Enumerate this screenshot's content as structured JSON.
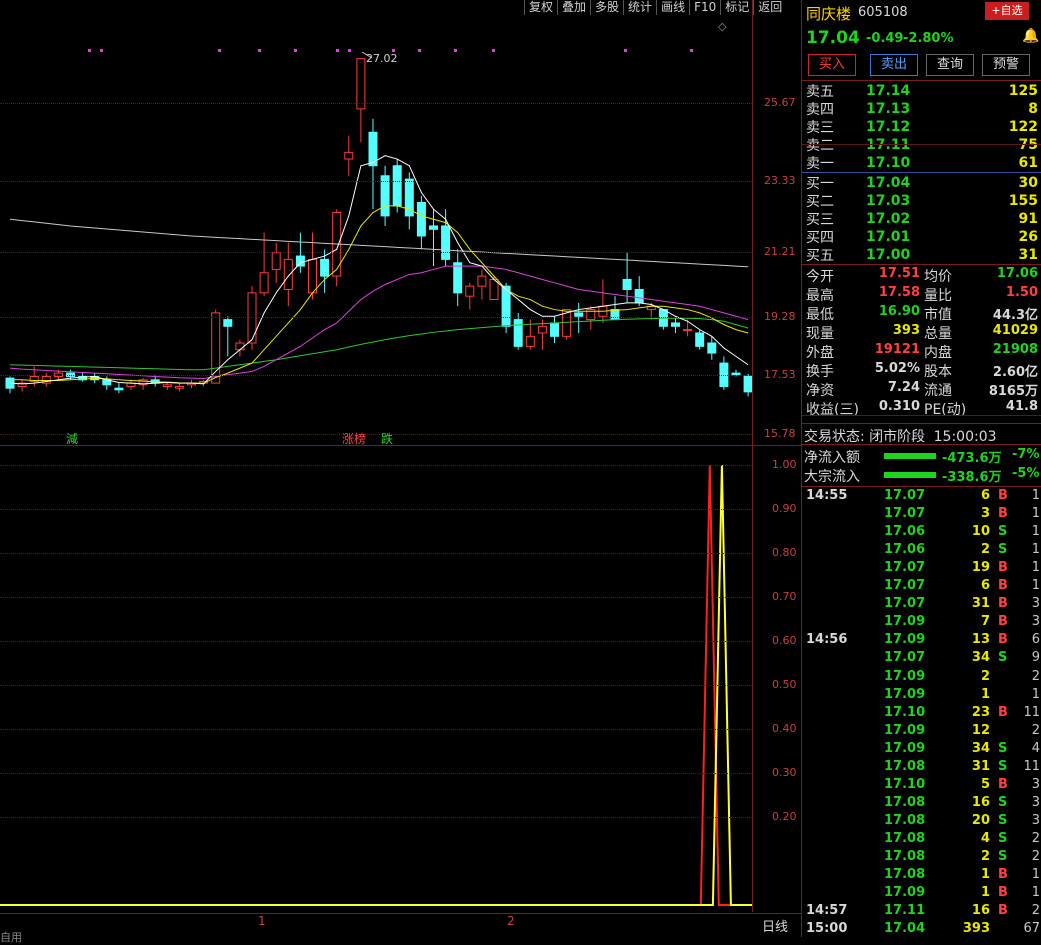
{
  "toolbar": [
    "复权",
    "叠加",
    "多股",
    "统计",
    "画线",
    "F10",
    "标记",
    "返回"
  ],
  "stock": {
    "name": "同庆楼",
    "code": "605108",
    "price": "17.04",
    "change": "-0.49",
    "pct": "-2.80%",
    "add_fav": "+自选"
  },
  "trade_buttons": {
    "buy": "买入",
    "sell": "卖出",
    "query": "查询",
    "alert": "预警"
  },
  "sell_orders": [
    {
      "label": "卖五",
      "price": "17.14",
      "vol": "125"
    },
    {
      "label": "卖四",
      "price": "17.13",
      "vol": "8"
    },
    {
      "label": "卖三",
      "price": "17.12",
      "vol": "122"
    },
    {
      "label": "卖二",
      "price": "17.11",
      "vol": "75"
    },
    {
      "label": "卖一",
      "price": "17.10",
      "vol": "61"
    }
  ],
  "buy_orders": [
    {
      "label": "买一",
      "price": "17.04",
      "vol": "30"
    },
    {
      "label": "买二",
      "price": "17.03",
      "vol": "155"
    },
    {
      "label": "买三",
      "price": "17.02",
      "vol": "91"
    },
    {
      "label": "买四",
      "price": "17.01",
      "vol": "26"
    },
    {
      "label": "买五",
      "price": "17.00",
      "vol": "31"
    }
  ],
  "quote": {
    "open_l": "今开",
    "open": "17.51",
    "avg_l": "均价",
    "avg": "17.06",
    "high_l": "最高",
    "high": "17.58",
    "vr_l": "量比",
    "vr": "1.50",
    "low_l": "最低",
    "low": "16.90",
    "mcap_l": "市值",
    "mcap": "44.3亿",
    "cur_l": "现量",
    "cur": "393",
    "tot_l": "总量",
    "tot": "41029",
    "out_l": "外盘",
    "out": "19121",
    "in_l": "内盘",
    "in": "21908",
    "turn_l": "换手",
    "turn": "5.02%",
    "shares_l": "股本",
    "shares": "2.60亿",
    "nav_l": "净资",
    "nav": "7.24",
    "float_l": "流通",
    "float": "8165万",
    "eps_l": "收益(三)",
    "eps": "0.310",
    "pe_l": "PE(动)",
    "pe": "41.8"
  },
  "status": {
    "label": "交易状态:",
    "state": "闭市阶段",
    "time": "15:00:03"
  },
  "flows": [
    {
      "label": "净流入额",
      "value": "-473.6万",
      "pct": "-7%"
    },
    {
      "label": "大宗流入",
      "value": "-338.6万",
      "pct": "-5%"
    }
  ],
  "ticks": [
    {
      "t": "14:55",
      "p": "17.07",
      "v": "6",
      "s": "B",
      "n": "1"
    },
    {
      "t": "",
      "p": "17.07",
      "v": "3",
      "s": "B",
      "n": "1"
    },
    {
      "t": "",
      "p": "17.06",
      "v": "10",
      "s": "S",
      "n": "1"
    },
    {
      "t": "",
      "p": "17.06",
      "v": "2",
      "s": "S",
      "n": "1"
    },
    {
      "t": "",
      "p": "17.07",
      "v": "19",
      "s": "B",
      "n": "1"
    },
    {
      "t": "",
      "p": "17.07",
      "v": "6",
      "s": "B",
      "n": "1"
    },
    {
      "t": "",
      "p": "17.07",
      "v": "31",
      "s": "B",
      "n": "3"
    },
    {
      "t": "",
      "p": "17.09",
      "v": "7",
      "s": "B",
      "n": "3"
    },
    {
      "t": "14:56",
      "p": "17.09",
      "v": "13",
      "s": "B",
      "n": "6"
    },
    {
      "t": "",
      "p": "17.07",
      "v": "34",
      "s": "S",
      "n": "9"
    },
    {
      "t": "",
      "p": "17.09",
      "v": "2",
      "s": "",
      "n": "2"
    },
    {
      "t": "",
      "p": "17.09",
      "v": "1",
      "s": "",
      "n": "1"
    },
    {
      "t": "",
      "p": "17.10",
      "v": "23",
      "s": "B",
      "n": "11"
    },
    {
      "t": "",
      "p": "17.09",
      "v": "12",
      "s": "",
      "n": "2"
    },
    {
      "t": "",
      "p": "17.09",
      "v": "34",
      "s": "S",
      "n": "4"
    },
    {
      "t": "",
      "p": "17.08",
      "v": "31",
      "s": "S",
      "n": "11"
    },
    {
      "t": "",
      "p": "17.10",
      "v": "5",
      "s": "B",
      "n": "3"
    },
    {
      "t": "",
      "p": "17.08",
      "v": "16",
      "s": "S",
      "n": "3"
    },
    {
      "t": "",
      "p": "17.08",
      "v": "20",
      "s": "S",
      "n": "3"
    },
    {
      "t": "",
      "p": "17.08",
      "v": "4",
      "s": "S",
      "n": "2"
    },
    {
      "t": "",
      "p": "17.08",
      "v": "2",
      "s": "S",
      "n": "2"
    },
    {
      "t": "",
      "p": "17.08",
      "v": "1",
      "s": "B",
      "n": "1"
    },
    {
      "t": "",
      "p": "17.09",
      "v": "1",
      "s": "B",
      "n": "1"
    },
    {
      "t": "14:57",
      "p": "17.11",
      "v": "16",
      "s": "B",
      "n": "2"
    },
    {
      "t": "15:00",
      "p": "17.04",
      "v": "393",
      "s": "",
      "n": "67"
    }
  ],
  "price_axis": [
    "25.67",
    "23.33",
    "21.21",
    "19.28",
    "17.53",
    "15.78"
  ],
  "indicator_axis": [
    "1.00",
    "0.90",
    "0.80",
    "0.70",
    "0.60",
    "0.50",
    "0.40",
    "0.30",
    "0.20"
  ],
  "max_label": "27.02",
  "chart_markers": {
    "m1": "減",
    "m2": "涨榜",
    "m3": "跌"
  },
  "x_labels": [
    "1",
    "2"
  ],
  "period_label": "日线",
  "bottom_tab": "自用",
  "colors": {
    "up": "#ff3c3c",
    "down": "#54ffff",
    "ma5": "#ffffff",
    "ma10": "#e8e800",
    "ma20": "#e040e0",
    "ma60": "#2ec82e",
    "ma120": "#c8c8c8"
  },
  "chart_data": {
    "type": "candlestick",
    "ylim": [
      15.78,
      27.5
    ],
    "candles": [
      [
        17.45,
        17.5,
        17.0,
        17.15
      ],
      [
        17.2,
        17.4,
        17.05,
        17.3
      ],
      [
        17.35,
        17.8,
        17.2,
        17.5
      ],
      [
        17.3,
        17.6,
        17.2,
        17.5
      ],
      [
        17.5,
        17.7,
        17.4,
        17.6
      ],
      [
        17.6,
        17.7,
        17.4,
        17.5
      ],
      [
        17.5,
        17.6,
        17.35,
        17.4
      ],
      [
        17.5,
        17.6,
        17.3,
        17.4
      ],
      [
        17.4,
        17.5,
        17.1,
        17.25
      ],
      [
        17.15,
        17.3,
        17.0,
        17.1
      ],
      [
        17.2,
        17.4,
        17.1,
        17.3
      ],
      [
        17.25,
        17.45,
        17.1,
        17.4
      ],
      [
        17.4,
        17.55,
        17.2,
        17.3
      ],
      [
        17.2,
        17.3,
        17.1,
        17.25
      ],
      [
        17.15,
        17.3,
        17.05,
        17.2
      ],
      [
        17.25,
        17.4,
        17.15,
        17.3
      ],
      [
        17.3,
        17.4,
        17.2,
        17.35
      ],
      [
        17.3,
        19.5,
        17.3,
        19.4
      ],
      [
        19.2,
        19.3,
        18.1,
        19.0
      ],
      [
        18.3,
        18.6,
        18.1,
        18.5
      ],
      [
        18.5,
        20.2,
        18.3,
        20.0
      ],
      [
        20.0,
        21.8,
        19.9,
        20.6
      ],
      [
        20.7,
        21.5,
        20.3,
        21.2
      ],
      [
        20.1,
        21.5,
        19.6,
        21.0
      ],
      [
        21.1,
        21.8,
        20.6,
        20.8
      ],
      [
        20.0,
        21.8,
        19.8,
        21.0
      ],
      [
        21.0,
        21.3,
        20.0,
        20.5
      ],
      [
        20.5,
        22.5,
        20.2,
        22.4
      ],
      [
        24.0,
        24.7,
        23.5,
        24.2
      ],
      [
        25.5,
        27.02,
        24.5,
        27.0
      ],
      [
        24.8,
        25.2,
        22.5,
        23.8
      ],
      [
        23.5,
        23.8,
        22.0,
        22.3
      ],
      [
        23.8,
        24.0,
        22.4,
        22.6
      ],
      [
        23.4,
        23.6,
        21.9,
        22.3
      ],
      [
        22.7,
        22.9,
        21.3,
        21.7
      ],
      [
        22.0,
        22.5,
        20.8,
        21.9
      ],
      [
        22.0,
        22.5,
        20.8,
        21.0
      ],
      [
        20.9,
        21.3,
        19.6,
        20.0
      ],
      [
        19.9,
        20.3,
        19.5,
        20.2
      ],
      [
        20.2,
        20.7,
        19.8,
        20.5
      ],
      [
        19.8,
        20.5,
        19.8,
        20.4
      ],
      [
        20.2,
        20.3,
        18.8,
        19.0
      ],
      [
        19.2,
        19.4,
        18.3,
        18.4
      ],
      [
        18.4,
        19.2,
        18.3,
        18.7
      ],
      [
        18.8,
        19.2,
        18.3,
        19.0
      ],
      [
        19.1,
        19.3,
        18.5,
        18.7
      ],
      [
        18.7,
        19.5,
        18.6,
        19.5
      ],
      [
        19.4,
        19.7,
        18.8,
        19.3
      ],
      [
        19.2,
        19.6,
        18.9,
        19.5
      ],
      [
        19.3,
        20.4,
        19.1,
        19.6
      ],
      [
        19.5,
        19.9,
        19.2,
        19.2
      ],
      [
        20.4,
        21.2,
        19.7,
        20.1
      ],
      [
        20.1,
        20.5,
        19.6,
        19.7
      ],
      [
        19.5,
        19.7,
        19.2,
        19.6
      ],
      [
        19.5,
        19.5,
        18.9,
        19.0
      ],
      [
        19.1,
        19.3,
        18.8,
        19.0
      ],
      [
        18.9,
        19.2,
        18.7,
        18.9
      ],
      [
        18.8,
        18.9,
        18.3,
        18.4
      ],
      [
        18.5,
        18.7,
        18.0,
        18.2
      ],
      [
        17.9,
        18.1,
        17.1,
        17.2
      ],
      [
        17.6,
        17.7,
        17.5,
        17.55
      ],
      [
        17.51,
        17.58,
        16.9,
        17.04
      ]
    ],
    "ma5": [
      17.3,
      17.28,
      17.3,
      17.35,
      17.4,
      17.45,
      17.48,
      17.5,
      17.4,
      17.32,
      17.3,
      17.28,
      17.3,
      17.32,
      17.3,
      17.3,
      17.28,
      17.65,
      18.0,
      18.3,
      18.6,
      19.4,
      20.0,
      20.5,
      20.9,
      21.0,
      21.1,
      21.3,
      22.3,
      23.8,
      23.9,
      24.1,
      24.0,
      23.8,
      23.0,
      22.5,
      22.2,
      21.5,
      20.9,
      20.8,
      20.4,
      20.1,
      19.8,
      19.5,
      19.3,
      19.3,
      19.4,
      19.5,
      19.55,
      19.6,
      19.65,
      19.7,
      19.7,
      19.65,
      19.5,
      19.3,
      19.15,
      18.9,
      18.7,
      18.35,
      18.1,
      17.85
    ],
    "ma10": [
      17.4,
      17.4,
      17.38,
      17.38,
      17.38,
      17.4,
      17.42,
      17.44,
      17.43,
      17.4,
      17.38,
      17.36,
      17.34,
      17.33,
      17.31,
      17.3,
      17.3,
      17.47,
      17.6,
      17.75,
      17.9,
      18.3,
      18.7,
      19.1,
      19.5,
      20.0,
      20.4,
      20.7,
      21.3,
      22.0,
      22.4,
      22.6,
      22.6,
      22.5,
      22.3,
      22.2,
      22.1,
      21.8,
      21.3,
      20.9,
      20.5,
      20.1,
      19.9,
      19.8,
      19.6,
      19.5,
      19.45,
      19.45,
      19.45,
      19.45,
      19.48,
      19.5,
      19.55,
      19.6,
      19.6,
      19.55,
      19.5,
      19.4,
      19.25,
      19.05,
      18.9,
      18.8
    ],
    "ma20": [
      17.75,
      17.72,
      17.7,
      17.68,
      17.66,
      17.64,
      17.62,
      17.6,
      17.58,
      17.56,
      17.54,
      17.52,
      17.5,
      17.48,
      17.46,
      17.45,
      17.44,
      17.5,
      17.55,
      17.6,
      17.65,
      17.8,
      18.0,
      18.2,
      18.4,
      18.65,
      18.9,
      19.1,
      19.45,
      19.8,
      20.05,
      20.25,
      20.4,
      20.55,
      20.6,
      20.7,
      20.8,
      20.8,
      20.8,
      20.8,
      20.75,
      20.7,
      20.6,
      20.5,
      20.4,
      20.3,
      20.2,
      20.1,
      20.05,
      20.0,
      19.95,
      19.9,
      19.85,
      19.8,
      19.75,
      19.7,
      19.65,
      19.6,
      19.5,
      19.4,
      19.3,
      19.2
    ],
    "ma60": [
      17.85,
      17.84,
      17.83,
      17.82,
      17.81,
      17.8,
      17.79,
      17.78,
      17.77,
      17.76,
      17.75,
      17.74,
      17.73,
      17.72,
      17.71,
      17.7,
      17.7,
      17.75,
      17.8,
      17.85,
      17.9,
      17.95,
      18.0,
      18.06,
      18.12,
      18.18,
      18.24,
      18.3,
      18.38,
      18.46,
      18.53,
      18.6,
      18.66,
      18.72,
      18.77,
      18.82,
      18.86,
      18.9,
      18.93,
      18.96,
      18.99,
      19.02,
      19.04,
      19.06,
      19.08,
      19.1,
      19.12,
      19.14,
      19.16,
      19.18,
      19.2,
      19.21,
      19.22,
      19.23,
      19.24,
      19.24,
      19.24,
      19.23,
      19.2,
      19.15,
      19.05,
      18.95
    ],
    "ma120": [
      22.2,
      22.16,
      22.12,
      22.08,
      22.04,
      22.0,
      21.97,
      21.94,
      21.91,
      21.88,
      21.85,
      21.82,
      21.79,
      21.76,
      21.73,
      21.7,
      21.68,
      21.66,
      21.64,
      21.62,
      21.6,
      21.58,
      21.56,
      21.54,
      21.52,
      21.5,
      21.48,
      21.46,
      21.44,
      21.42,
      21.4,
      21.38,
      21.36,
      21.34,
      21.32,
      21.3,
      21.28,
      21.26,
      21.24,
      21.22,
      21.2,
      21.18,
      21.16,
      21.14,
      21.12,
      21.1,
      21.08,
      21.06,
      21.04,
      21.02,
      21.0,
      20.98,
      20.96,
      20.94,
      20.92,
      20.9,
      20.88,
      20.86,
      20.84,
      20.82,
      20.8,
      20.78
    ],
    "indicator": {
      "ylim": [
        0,
        1.0
      ],
      "red": [
        0,
        0,
        0,
        0,
        0,
        0,
        0,
        0,
        0,
        0,
        0,
        0,
        0,
        0,
        0,
        0,
        0,
        0,
        0,
        0,
        0,
        0,
        0,
        0,
        0,
        0,
        0,
        0,
        0,
        0,
        0,
        0,
        0,
        0,
        0,
        0,
        0,
        0,
        0,
        0,
        0,
        0,
        0,
        0,
        0,
        0,
        0,
        0,
        0,
        0,
        0,
        0,
        0,
        0,
        0,
        0,
        0,
        0,
        1,
        0,
        0,
        0
      ],
      "yellow": [
        0,
        0,
        0,
        0,
        0,
        0,
        0,
        0,
        0,
        0,
        0,
        0,
        0,
        0,
        0,
        0,
        0,
        0,
        0,
        0,
        0,
        0,
        0,
        0,
        0,
        0,
        0,
        0,
        0,
        0,
        0,
        0,
        0,
        0,
        0,
        0,
        0,
        0,
        0,
        0,
        0,
        0,
        0,
        0,
        0,
        0,
        0,
        0,
        0,
        0,
        0,
        0,
        0,
        0,
        0,
        0,
        0,
        0,
        0,
        1,
        0,
        0
      ]
    }
  }
}
